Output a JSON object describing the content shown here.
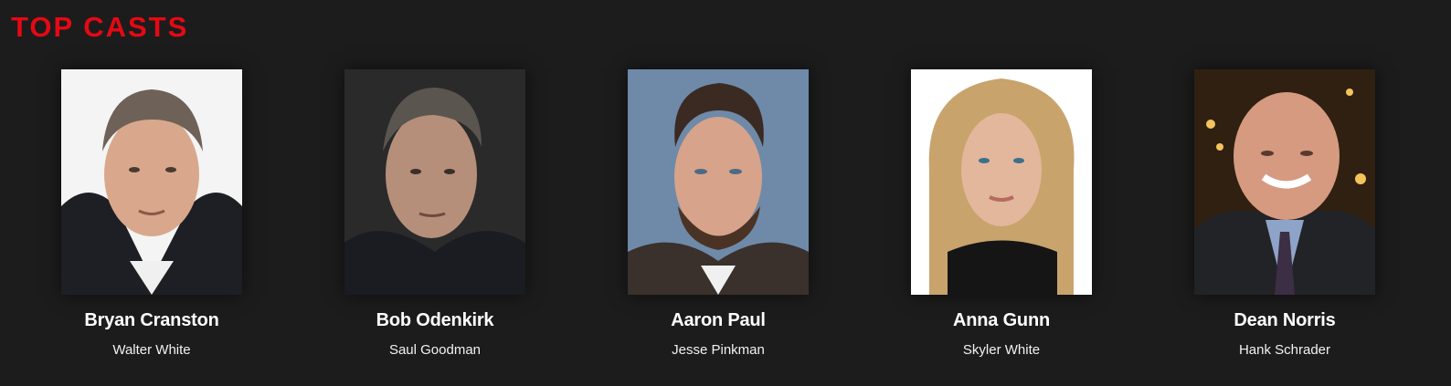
{
  "section": {
    "title": "TOP CASTS",
    "title_color": "#e50914"
  },
  "cast": [
    {
      "name": "Bryan Cranston",
      "role": "Walter White",
      "image": "portrait-photo"
    },
    {
      "name": "Bob Odenkirk",
      "role": "Saul Goodman",
      "image": "portrait-photo"
    },
    {
      "name": "Aaron Paul",
      "role": "Jesse Pinkman",
      "image": "portrait-photo"
    },
    {
      "name": "Anna Gunn",
      "role": "Skyler White",
      "image": "portrait-photo"
    },
    {
      "name": "Dean Norris",
      "role": "Hank Schrader",
      "image": "portrait-photo"
    }
  ]
}
